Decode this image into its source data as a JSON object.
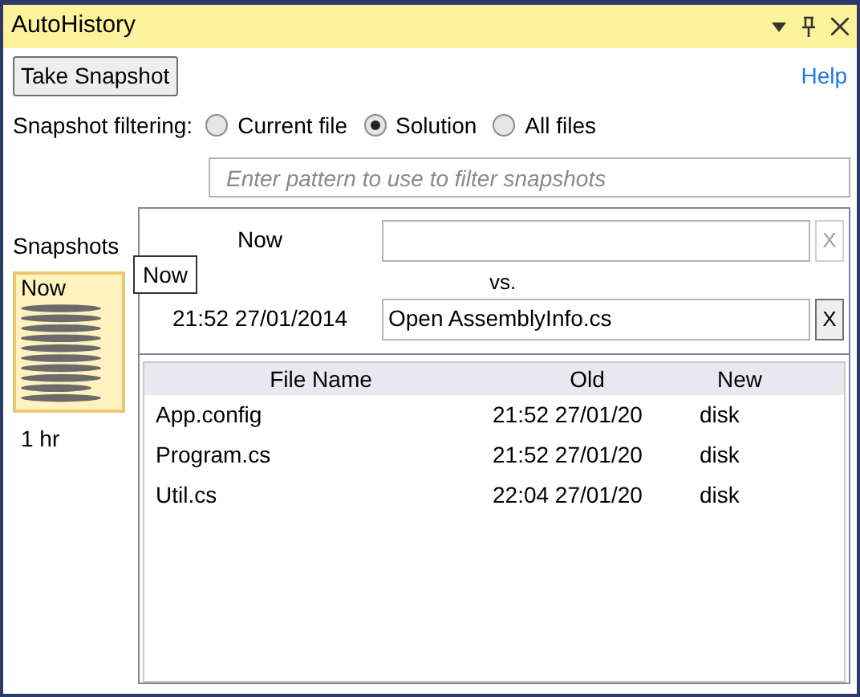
{
  "window": {
    "title": "AutoHistory"
  },
  "toolbar": {
    "snapshot_button": "Take Snapshot",
    "help_link": "Help"
  },
  "filtering": {
    "label": "Snapshot filtering:",
    "options": [
      {
        "label": "Current file",
        "selected": false
      },
      {
        "label": "Solution",
        "selected": true
      },
      {
        "label": "All files",
        "selected": false
      }
    ]
  },
  "filter_field": {
    "placeholder": "Enter pattern to use to filter snapshots"
  },
  "snapshots": {
    "title": "Snapshots",
    "items": [
      {
        "label": "Now",
        "selected": true
      },
      {
        "label": "1 hr",
        "selected": false
      }
    ],
    "tooltip": "Now"
  },
  "compare": {
    "left": {
      "label": "Now",
      "clear": "X",
      "clear_enabled": false
    },
    "separator": "vs.",
    "right": {
      "label": "21:52 27/01/2014",
      "value": "Open AssemblyInfo.cs",
      "clear": "X",
      "clear_enabled": true
    }
  },
  "table": {
    "columns": [
      "File Name",
      "Old",
      "New"
    ],
    "rows": [
      {
        "name": "App.config",
        "old": "21:52 27/01/20",
        "new": "disk"
      },
      {
        "name": "Program.cs",
        "old": "21:52 27/01/20",
        "new": "disk"
      },
      {
        "name": "Util.cs",
        "old": "22:04 27/01/20",
        "new": "disk"
      }
    ]
  }
}
